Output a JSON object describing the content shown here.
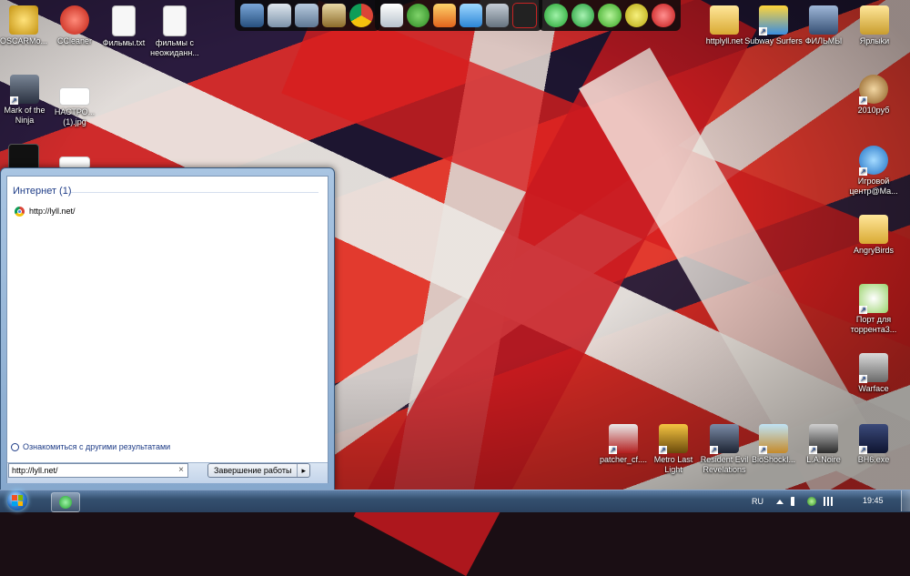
{
  "desktop": {
    "icons_left": [
      {
        "label": "OSCARMo...",
        "icon": "oscar-mouse-icon"
      },
      {
        "label": "CCleaner",
        "icon": "ccleaner-icon"
      },
      {
        "label": "Фильмы.txt",
        "icon": "text-file-icon"
      },
      {
        "label": "фильмы с неожиданн...",
        "icon": "text-file-icon"
      },
      {
        "label": "Mark of the Ninja",
        "icon": "game-ninja-icon"
      },
      {
        "label": "НАСТРО... (1).jpg",
        "icon": "image-file-icon"
      }
    ],
    "icons_right": [
      {
        "label": "httplyll.net",
        "icon": "folder-icon"
      },
      {
        "label": "Subway Surfers",
        "icon": "subway-surfers-icon"
      },
      {
        "label": "ФИЛЬМЫ",
        "icon": "films-folder-icon"
      },
      {
        "label": "Ярлыkи",
        "icon": "folder-icon"
      },
      {
        "label": "2010руб",
        "icon": "game-robot-icon"
      },
      {
        "label": "Игровой центр@Ma...",
        "icon": "game-center-icon"
      },
      {
        "label": "AngryBirds",
        "icon": "folder-icon"
      },
      {
        "label": "Порт для торрента3...",
        "icon": "plants-icon"
      },
      {
        "label": "Warface",
        "icon": "warface-icon"
      }
    ],
    "icons_bottom": [
      {
        "label": "patcher_cf....",
        "icon": "crossfire-icon"
      },
      {
        "label": "Metro Last Light",
        "icon": "metro-icon"
      },
      {
        "label": "Resident Evil Revelations",
        "icon": "resident-evil-icon"
      },
      {
        "label": "BioShockI...",
        "icon": "bioshock-icon"
      },
      {
        "label": "L.A.Noire",
        "icon": "la-noire-icon"
      },
      {
        "label": "BH6.exe",
        "icon": "bh6-icon"
      }
    ]
  },
  "start_menu": {
    "section_heading": "Интернет (1)",
    "result_label": "http://lyll.net/",
    "more_results": "Ознакомиться с другими результатами",
    "search_value": "http://lyll.net/",
    "shutdown_label": "Завершение работы",
    "shutdown_arrow": "▸",
    "clear_glyph": "×"
  },
  "taskbar": {
    "language": "RU",
    "clock": "19:45"
  },
  "colors": {
    "accent": "#1e3c87",
    "taskbar": "#34506f"
  }
}
